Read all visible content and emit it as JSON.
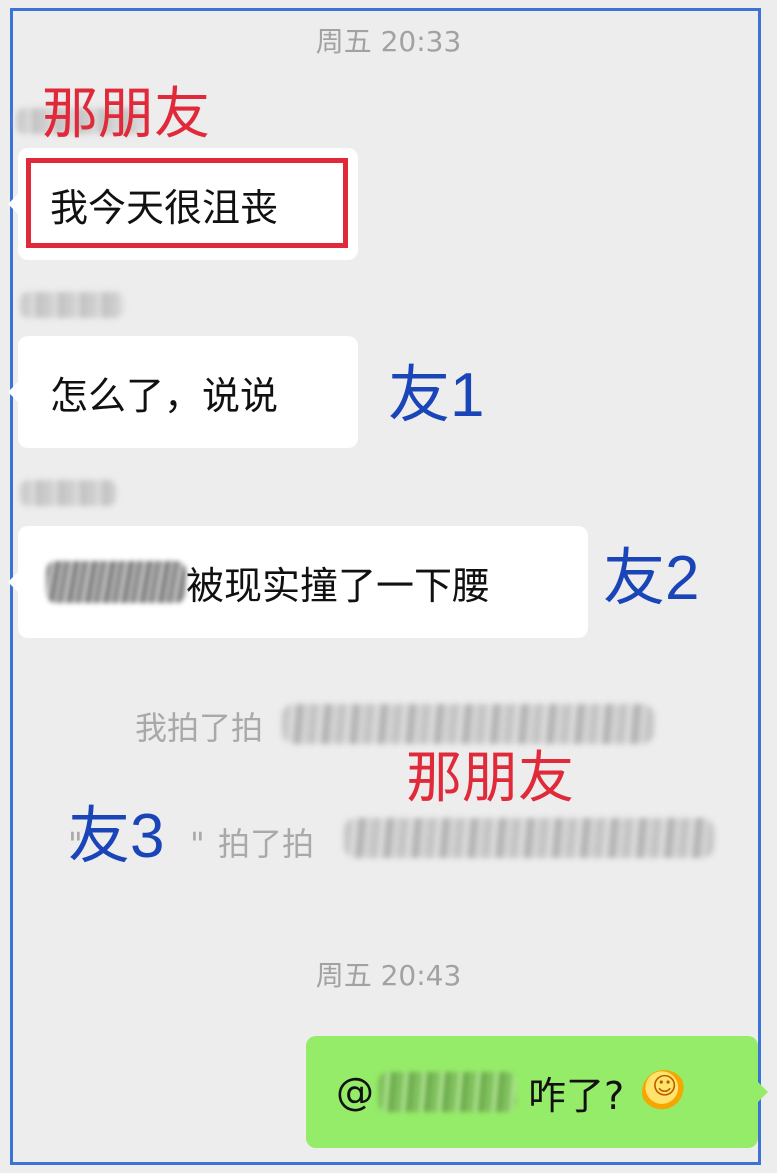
{
  "timestamps": [
    "周五 20:33",
    "周五 20:43"
  ],
  "messages": [
    {
      "text": "我今天很沮丧"
    },
    {
      "text": "怎么了，说说"
    },
    {
      "text": "被现实撞了一下腰"
    }
  ],
  "system": {
    "pat1": "我拍了拍",
    "pat2_open_quote": "\"",
    "pat2_close_quote": "\"",
    "pat2_text": "拍了拍"
  },
  "outgoing": {
    "at": "@",
    "text": "咋了?",
    "emoji": "sun-emoji"
  },
  "annotations": {
    "top_red": "那朋友",
    "friend1": "友1",
    "friend2": "友2",
    "mid_red": "那朋友",
    "friend3": "友3"
  },
  "colors": {
    "annotation_red": "#e02a3a",
    "annotation_blue": "#1a45b8",
    "frame_blue": "#3b73d6",
    "outgoing_green": "#95ec69"
  }
}
